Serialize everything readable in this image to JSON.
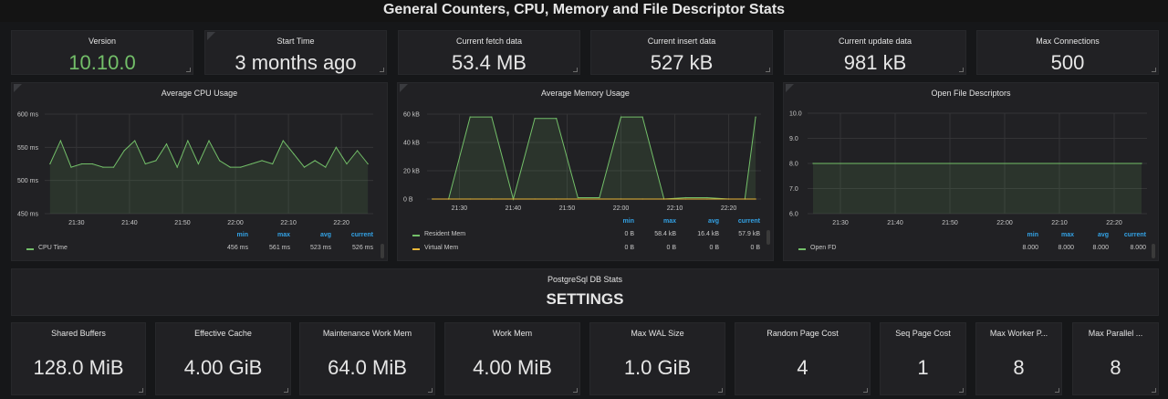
{
  "header": {
    "title": "General Counters, CPU, Memory and File Descriptor Stats"
  },
  "top_stats": [
    {
      "title": "Version",
      "value": "10.10.0",
      "color": "#73bf69",
      "info": false
    },
    {
      "title": "Start Time",
      "value": "3 months ago",
      "color": "#e6e6e6",
      "info": true
    },
    {
      "title": "Current fetch data",
      "value": "53.4 MB",
      "color": "#e6e6e6",
      "info": false
    },
    {
      "title": "Current insert data",
      "value": "527 kB",
      "color": "#e6e6e6",
      "info": false
    },
    {
      "title": "Current update data",
      "value": "981 kB",
      "color": "#e6e6e6",
      "info": false
    },
    {
      "title": "Max Connections",
      "value": "500",
      "color": "#e6e6e6",
      "info": false
    }
  ],
  "graphs": {
    "cpu": {
      "title": "Average CPU Usage",
      "yticks": [
        "600 ms",
        "550 ms",
        "500 ms",
        "450 ms"
      ],
      "xticks": [
        "21:30",
        "21:40",
        "21:50",
        "22:00",
        "22:10",
        "22:20"
      ],
      "legend_headers": [
        "min",
        "max",
        "avg",
        "current"
      ],
      "series": [
        {
          "name": "CPU Time",
          "color": "#73bf69",
          "min": "456 ms",
          "max": "561 ms",
          "avg": "523 ms",
          "current": "526 ms"
        }
      ]
    },
    "memory": {
      "title": "Average Memory Usage",
      "yticks": [
        "60 kB",
        "40 kB",
        "20 kB",
        "0 B"
      ],
      "xticks": [
        "21:30",
        "21:40",
        "21:50",
        "22:00",
        "22:10",
        "22:20"
      ],
      "legend_headers": [
        "min",
        "max",
        "avg",
        "current"
      ],
      "series": [
        {
          "name": "Resident Mem",
          "color": "#73bf69",
          "min": "0 B",
          "max": "58.4 kB",
          "avg": "16.4 kB",
          "current": "57.9 kB"
        },
        {
          "name": "Virtual Mem",
          "color": "#eab839",
          "min": "0 B",
          "max": "0 B",
          "avg": "0 B",
          "current": "0 B"
        }
      ]
    },
    "fd": {
      "title": "Open File Descriptors",
      "yticks": [
        "10.0",
        "9.0",
        "8.0",
        "7.0",
        "6.0"
      ],
      "xticks": [
        "21:30",
        "21:40",
        "21:50",
        "22:00",
        "22:10",
        "22:20"
      ],
      "legend_headers": [
        "min",
        "max",
        "avg",
        "current"
      ],
      "series": [
        {
          "name": "Open FD",
          "color": "#73bf69",
          "min": "8.000",
          "max": "8.000",
          "avg": "8.000",
          "current": "8.000"
        }
      ]
    }
  },
  "db_section": {
    "subtitle": "PostgreSql DB Stats",
    "title": "SETTINGS"
  },
  "settings_stats": [
    {
      "title": "Shared Buffers",
      "value": "128.0 MiB"
    },
    {
      "title": "Effective Cache",
      "value": "4.00 GiB"
    },
    {
      "title": "Maintenance Work Mem",
      "value": "64.0 MiB"
    },
    {
      "title": "Work Mem",
      "value": "4.00 MiB"
    },
    {
      "title": "Max WAL Size",
      "value": "1.0 GiB"
    },
    {
      "title": "Random Page Cost",
      "value": "4"
    },
    {
      "title": "Seq Page Cost",
      "value": "1"
    },
    {
      "title": "Max Worker P...",
      "value": "8"
    },
    {
      "title": "Max Parallel ...",
      "value": "8"
    }
  ],
  "chart_data": [
    {
      "type": "line",
      "title": "Average CPU Usage",
      "x": [
        "21:25",
        "21:27",
        "21:29",
        "21:31",
        "21:33",
        "21:35",
        "21:37",
        "21:39",
        "21:41",
        "21:43",
        "21:45",
        "21:47",
        "21:49",
        "21:51",
        "21:53",
        "21:55",
        "21:57",
        "21:59",
        "22:01",
        "22:03",
        "22:05",
        "22:07",
        "22:09",
        "22:11",
        "22:13",
        "22:15",
        "22:17",
        "22:19",
        "22:21",
        "22:23",
        "22:25"
      ],
      "series": [
        {
          "name": "CPU Time",
          "values": [
            525,
            560,
            520,
            525,
            525,
            520,
            520,
            545,
            560,
            525,
            530,
            555,
            520,
            560,
            525,
            560,
            530,
            520,
            520,
            525,
            530,
            525,
            560,
            540,
            520,
            530,
            520,
            550,
            525,
            545,
            525
          ]
        }
      ],
      "ylim": [
        450,
        600
      ]
    },
    {
      "type": "area",
      "title": "Average Memory Usage",
      "x": [
        "21:25",
        "21:28",
        "21:32",
        "21:36",
        "21:40",
        "21:44",
        "21:48",
        "21:52",
        "21:56",
        "22:00",
        "22:04",
        "22:08",
        "22:12",
        "22:16",
        "22:20",
        "22:23",
        "22:25"
      ],
      "series": [
        {
          "name": "Resident Mem",
          "values": [
            0,
            0,
            58,
            58,
            0,
            57,
            57,
            1,
            1,
            58,
            58,
            0,
            1,
            1,
            0,
            0,
            58
          ]
        },
        {
          "name": "Virtual Mem",
          "values": [
            0,
            0,
            0,
            0,
            0,
            0,
            0,
            0,
            0,
            0,
            0,
            0,
            0,
            0,
            0,
            0,
            0
          ]
        }
      ],
      "ylim": [
        0,
        60
      ]
    },
    {
      "type": "area",
      "title": "Open File Descriptors",
      "x": [
        "21:25",
        "22:25"
      ],
      "series": [
        {
          "name": "Open FD",
          "values": [
            8,
            8
          ]
        }
      ],
      "ylim": [
        6,
        10
      ]
    }
  ]
}
